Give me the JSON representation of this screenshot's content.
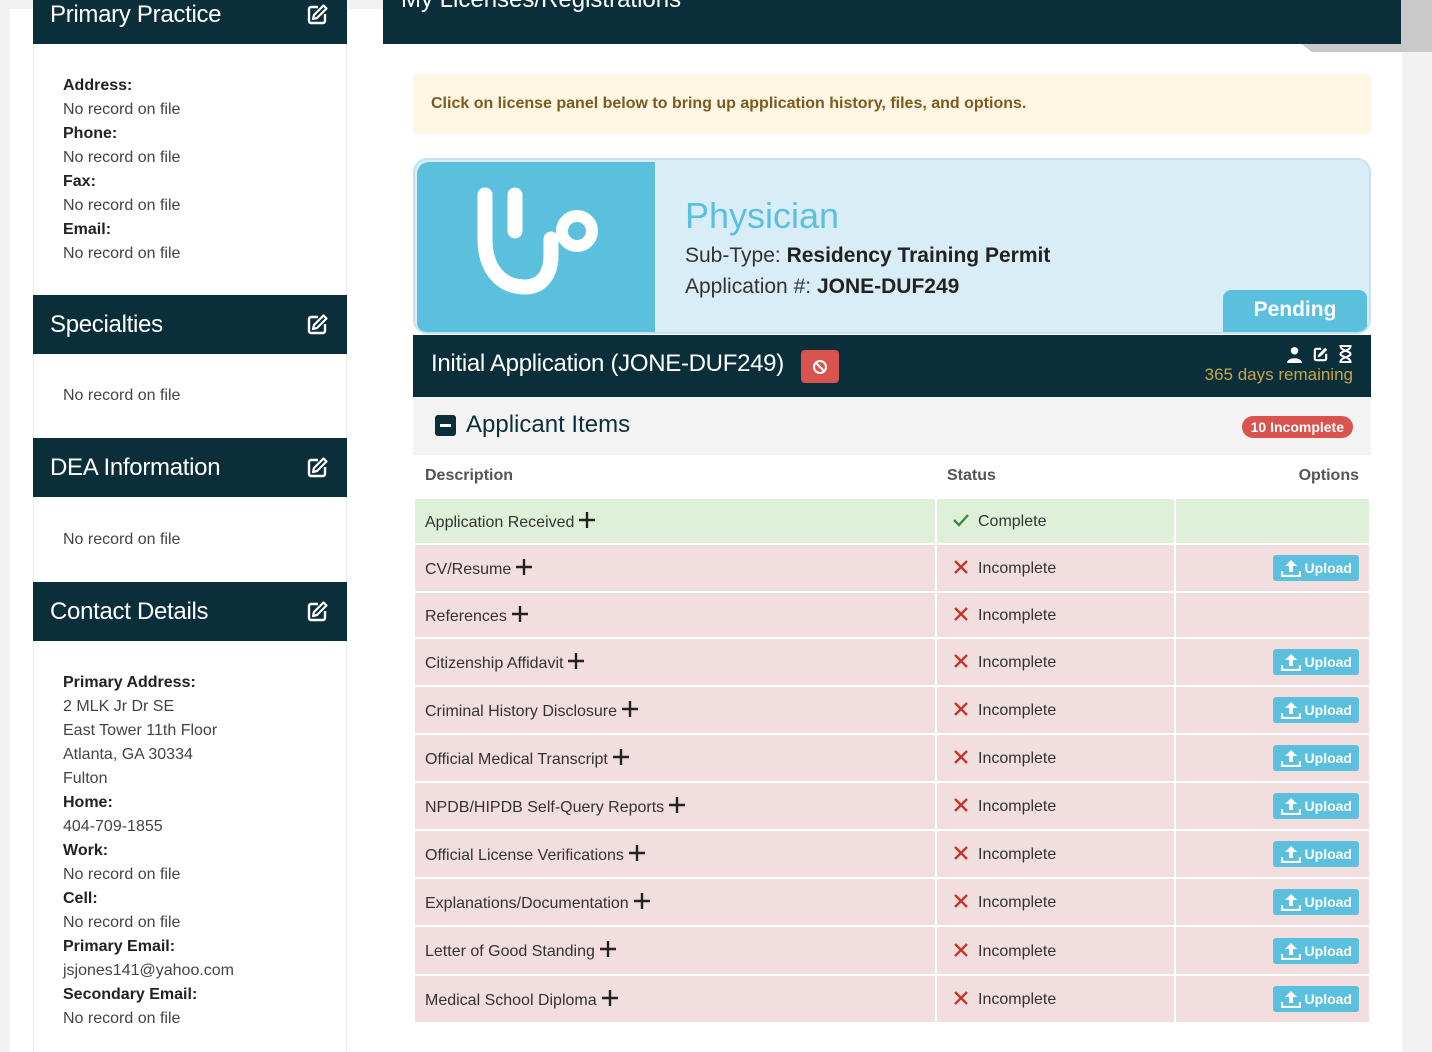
{
  "left": {
    "primary_practice": {
      "title": "Primary Practice",
      "fields": [
        {
          "label": "Address:",
          "value": "No record on file"
        },
        {
          "label": "Phone:",
          "value": "No record on file"
        },
        {
          "label": "Fax:",
          "value": "No record on file"
        },
        {
          "label": "Email:",
          "value": "No record on file"
        }
      ]
    },
    "specialties": {
      "title": "Specialties",
      "value": "No record on file"
    },
    "dea": {
      "title": "DEA Information",
      "value": "No record on file"
    },
    "contact": {
      "title": "Contact Details",
      "primary_address_label": "Primary Address:",
      "address_lines": [
        "2 MLK Jr Dr SE",
        "East Tower 11th Floor",
        "Atlanta, GA 30334",
        "Fulton"
      ],
      "home_label": "Home:",
      "home_value": "404-709-1855",
      "work_label": "Work:",
      "work_value": "No record on file",
      "cell_label": "Cell:",
      "cell_value": "No record on file",
      "primary_email_label": "Primary Email:",
      "primary_email_value": "jsjones141@yahoo.com",
      "secondary_email_label": "Secondary Email:",
      "secondary_email_value": "No record on file"
    }
  },
  "main": {
    "title": "My Licenses/Registrations",
    "alert": "Click on license panel below to bring up application history, files, and options.",
    "license": {
      "title": "Physician",
      "subtype_label": "Sub-Type:",
      "subtype_value": "Residency Training Permit",
      "appnum_label": "Application #:",
      "appnum_value": "JONE-DUF249",
      "status": "Pending",
      "icon": "stethoscope-icon"
    },
    "application": {
      "title": "Initial Application (JONE-DUF249)",
      "days_remaining": "365 days remaining"
    },
    "items": {
      "title": "Applicant Items",
      "badge": "10 Incomplete",
      "columns": [
        "Description",
        "Status",
        "Options"
      ],
      "upload_label": "Upload",
      "rows": [
        {
          "desc": "Application Received",
          "status": "Complete",
          "upload": false
        },
        {
          "desc": "CV/Resume",
          "status": "Incomplete",
          "upload": true
        },
        {
          "desc": "References",
          "status": "Incomplete",
          "upload": false
        },
        {
          "desc": "Citizenship Affidavit",
          "status": "Incomplete",
          "upload": true
        },
        {
          "desc": "Criminal History Disclosure",
          "status": "Incomplete",
          "upload": true
        },
        {
          "desc": "Official Medical Transcript",
          "status": "Incomplete",
          "upload": true
        },
        {
          "desc": "NPDB/HIPDB Self-Query Reports",
          "status": "Incomplete",
          "upload": true
        },
        {
          "desc": "Official License Verifications",
          "status": "Incomplete",
          "upload": true
        },
        {
          "desc": "Explanations/Documentation",
          "status": "Incomplete",
          "upload": true
        },
        {
          "desc": "Letter of Good Standing",
          "status": "Incomplete",
          "upload": true
        },
        {
          "desc": "Medical School Diploma",
          "status": "Incomplete",
          "upload": true
        }
      ]
    }
  },
  "colors": {
    "header_bg": "#0b2f3a",
    "info": "#5bc0de",
    "danger": "#d9534f",
    "success_row": "#dff0d8",
    "danger_row": "#f2dede"
  }
}
